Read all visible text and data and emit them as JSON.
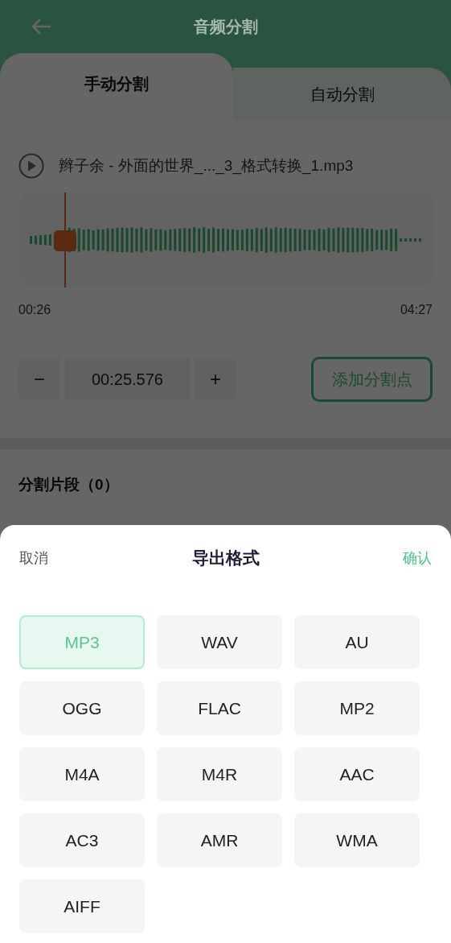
{
  "header": {
    "title": "音频分割"
  },
  "tabs": [
    {
      "label": "手动分割",
      "selected": true
    },
    {
      "label": "自动分割",
      "selected": false
    }
  ],
  "file": {
    "name": "辫子余 - 外面的世界_..._3_格式转换_1.mp3"
  },
  "waveform": {
    "start": "00:26",
    "end": "04:27"
  },
  "stepper": {
    "minus": "−",
    "value": "00:25.576",
    "plus": "+"
  },
  "add_button": "添加分割点",
  "segments": {
    "title": "分割片段（0）"
  },
  "sheet": {
    "cancel": "取消",
    "title": "导出格式",
    "confirm": "确认",
    "formats": [
      {
        "label": "MP3",
        "selected": true
      },
      {
        "label": "WAV",
        "selected": false
      },
      {
        "label": "AU",
        "selected": false
      },
      {
        "label": "OGG",
        "selected": false
      },
      {
        "label": "FLAC",
        "selected": false
      },
      {
        "label": "MP2",
        "selected": false
      },
      {
        "label": "M4A",
        "selected": false
      },
      {
        "label": "M4R",
        "selected": false
      },
      {
        "label": "AAC",
        "selected": false
      },
      {
        "label": "AC3",
        "selected": false
      },
      {
        "label": "AMR",
        "selected": false
      },
      {
        "label": "WMA",
        "selected": false
      },
      {
        "label": "AIFF",
        "selected": false
      }
    ]
  }
}
